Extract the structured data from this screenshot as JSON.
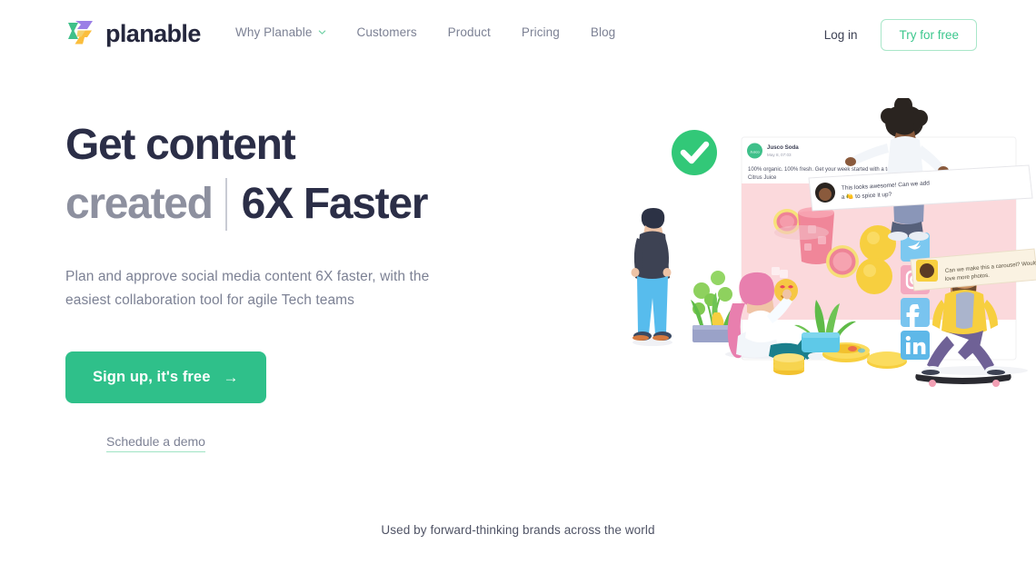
{
  "header": {
    "brand": {
      "name": "planable",
      "logo_icon": "planable-pinwheel-logo"
    },
    "nav": [
      {
        "label": "Why Planable",
        "has_dropdown": true,
        "icon": "chevron-down-icon"
      },
      {
        "label": "Customers",
        "has_dropdown": false
      },
      {
        "label": "Product",
        "has_dropdown": false
      },
      {
        "label": "Pricing",
        "has_dropdown": false
      },
      {
        "label": "Blog",
        "has_dropdown": false
      }
    ],
    "login_label": "Log in",
    "try_label": "Try for free"
  },
  "hero": {
    "title_line1": "Get content",
    "title_line2_muted": "created",
    "title_line2_strong": "6X Faster",
    "subtitle": "Plan and approve social media content 6X faster, with the easiest collaboration tool for agile Tech teams",
    "cta_primary": "Sign up, it's free",
    "cta_primary_arrow": "→",
    "cta_secondary": "Schedule a demo"
  },
  "proof": {
    "text": "Used by forward-thinking brands across the world"
  },
  "illustration": {
    "alt": "3D illustration of a team collaborating around a social media post",
    "approved_icon": "green-check-circle-icon",
    "post": {
      "author": "Jusco Soda",
      "timestamp": "May 8, 07:03",
      "body": "100% organic. 100% fresh. Get your week started with a taste of our Citrus Juice",
      "avatar_label": "Jusco",
      "image_alt": "Pink flatlay with grapefruit slices and lemons"
    },
    "comments": [
      {
        "text": "This looks awesome! Can we add a 🍋 to spice it up?",
        "avatar": "avatar-curly-hair"
      },
      {
        "text": "Can we make this a carousel? Would love more photos.",
        "avatar": "avatar-bearded-man"
      }
    ],
    "social_icons": [
      "twitter-icon",
      "instagram-icon",
      "facebook-icon",
      "linkedin-icon"
    ]
  },
  "colors": {
    "brand_green": "#2fc08a",
    "green_outline": "#a9e7c9",
    "heading_navy": "#2b2e47",
    "muted_gray": "#8d909f",
    "body_gray": "#7c8194",
    "post_image_pink": "#fbd9dc",
    "twitter_blue": "#7cc8f0",
    "instagram_pink": "#f4a9c0",
    "facebook_blue": "#79c4ef",
    "linkedin_blue": "#5eb8e8"
  }
}
